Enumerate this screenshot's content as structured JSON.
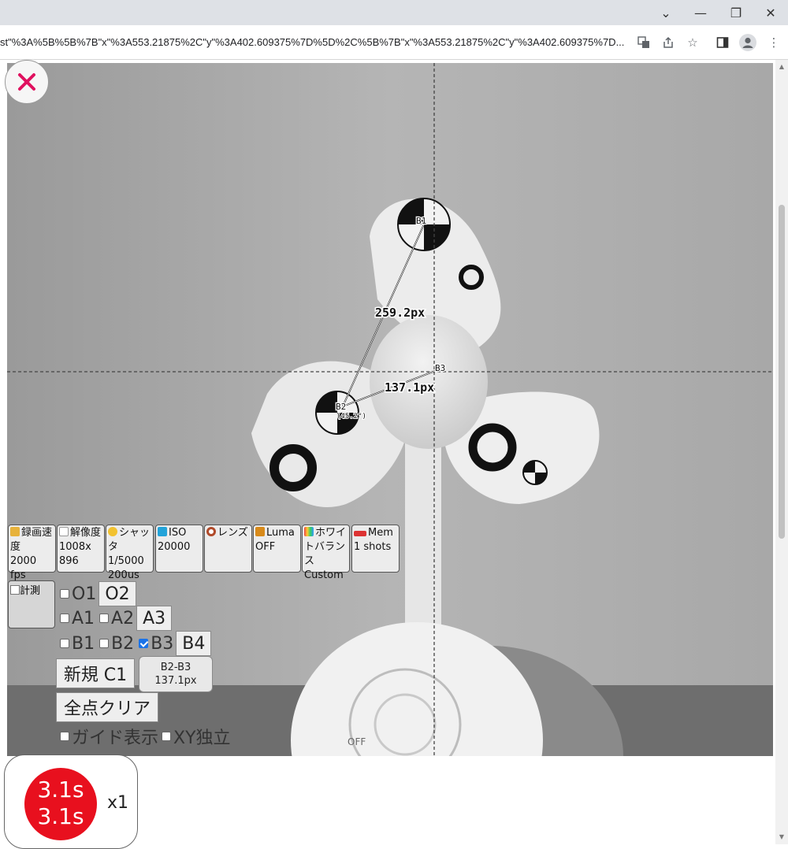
{
  "browser": {
    "url": "st\"%3A%5B%5B%7B\"x\"%3A553.21875%2C\"y\"%3A402.609375%7D%5D%2C%5B%7B\"x\"%3A553.21875%2C\"y\"%3A402.609375%7D..."
  },
  "overlay": {
    "points": {
      "b1": "B1",
      "b2": "B2",
      "b3": "B3",
      "angle": "(45.2°)"
    },
    "distances": {
      "b1_b2": "259.2px",
      "b2_b3": "137.1px"
    },
    "fan": {
      "off_label": "OFF"
    }
  },
  "menu": [
    {
      "label": "録画速度",
      "value": "2000 fps",
      "icon_color": "#e7b23b"
    },
    {
      "label": "解像度",
      "value": "1008x 896",
      "icon_color": "#ffffff"
    },
    {
      "label": "シャッタ",
      "value": "1/5000 200us",
      "icon_color": "#f2c230"
    },
    {
      "label": "ISO",
      "value": "20000",
      "icon_color": "#23a3d9"
    },
    {
      "label": "レンズ",
      "value": "",
      "icon_color": "#b04a2a"
    },
    {
      "label": "Luma",
      "value": "OFF",
      "icon_color": "#d88a1a"
    },
    {
      "label": "ホワイトバランス",
      "value": "Custom",
      "icon_color": "#e44"
    },
    {
      "label": "Mem",
      "value": "1 shots",
      "icon_color": "#d33"
    }
  ],
  "measure": {
    "label": "計測",
    "rows": {
      "o": {
        "items": [
          "O1"
        ],
        "button": "O2"
      },
      "a": {
        "items": [
          "A1",
          "A2"
        ],
        "button": "A3"
      },
      "b": {
        "items": [
          "B1",
          "B2",
          "B3"
        ],
        "button": "B4"
      }
    },
    "new_button": "新規 C1",
    "result_pair": "B2-B3",
    "result_value": "137.1px",
    "clear_button": "全点クリア",
    "guide_label": "ガイド表示",
    "xy_label": "XY独立"
  },
  "timer": {
    "line1": "3.1s",
    "line2": "3.1s",
    "multiplier": "x1"
  }
}
